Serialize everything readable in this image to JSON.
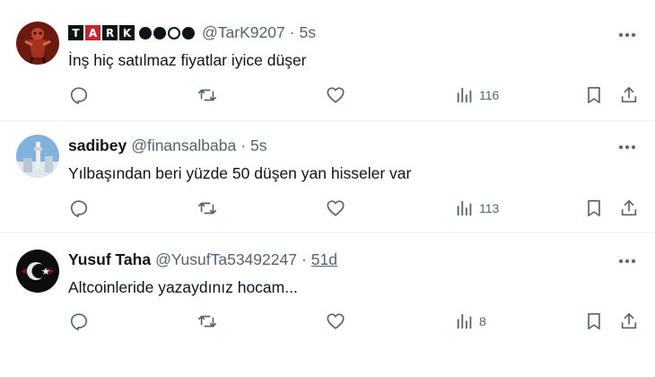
{
  "tweets": [
    {
      "avatar_icon": "red-mask-figure-avatar",
      "display_name_logo_letters": [
        "T",
        "A",
        "R",
        "K"
      ],
      "handle": "@TarK9207",
      "dot": "·",
      "time": "5s",
      "text": "İnş hiç satılmaz fiyatlar iyice düşer",
      "views": "116"
    },
    {
      "avatar_icon": "skyline-tower-avatar",
      "display_name": "sadibey",
      "handle": "@finansalbaba",
      "dot": "·",
      "time": "5s",
      "text": "Yılbaşından beri yüzde 50 düşen yan hisseler var",
      "views": "113"
    },
    {
      "avatar_icon": "crescent-star-avatar",
      "display_name": "Yusuf Taha",
      "handle": "@YusufTa53492247",
      "dot": "·",
      "time": "51d",
      "text": "Altcoinleride yazaydınız hocam...",
      "views": "8"
    }
  ],
  "colors": {
    "text_primary": "#0f1419",
    "text_secondary": "#536471",
    "divider": "#eff3f4"
  }
}
